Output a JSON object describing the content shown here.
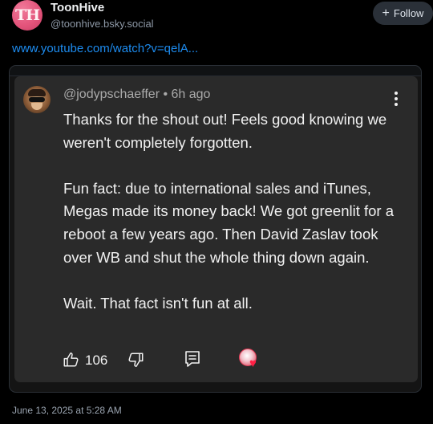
{
  "author": {
    "avatar_text": "TH",
    "display_name": "ToonHive",
    "handle": "@toonhive.bsky.social"
  },
  "follow_button": {
    "label": "Follow",
    "icon": "plus-icon"
  },
  "post": {
    "link": "www.youtube.com/watch?v=qelA...",
    "timestamp": "June 13, 2025 at 5:28 AM"
  },
  "comment": {
    "meta": "@jodypschaeffer • 6h ago",
    "paragraphs": [
      "Thanks for the shout out! Feels good knowing we weren't completely forgotten.",
      "Fun fact: due to international sales and iTunes, Megas made its money back! We got greenlit for a reboot a few years ago. Then David Zaslav took over WB and shut the whole thing down again.",
      "Wait. That fact isn't fun at all."
    ],
    "likes": "106"
  },
  "colors": {
    "accent_link": "#1d8cf0",
    "avatar_pink": "#e4557c",
    "card_background": "#2a2a2a",
    "heart_red": "#ff1f44"
  }
}
